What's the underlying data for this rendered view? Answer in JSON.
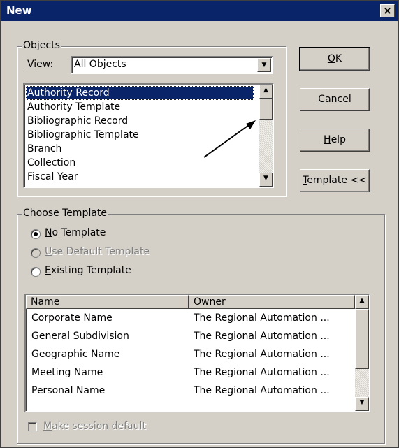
{
  "dialog": {
    "title": "New",
    "close_label": "×"
  },
  "objects": {
    "legend": "Objects",
    "view_label_pre": "",
    "view_label_key": "V",
    "view_label_post": "iew:",
    "view_value": "All Objects",
    "items": [
      {
        "label": "Authority Record",
        "selected": true
      },
      {
        "label": "Authority Template"
      },
      {
        "label": "Bibliographic Record"
      },
      {
        "label": "Bibliographic Template"
      },
      {
        "label": "Branch"
      },
      {
        "label": "Collection"
      },
      {
        "label": "Fiscal Year"
      }
    ]
  },
  "buttons": {
    "ok_key": "O",
    "ok_rest": "K",
    "cancel_key": "C",
    "cancel_rest": "ancel",
    "help_key": "H",
    "help_rest": "elp",
    "template_key": "T",
    "template_rest": "emplate <<"
  },
  "choose_template": {
    "legend": "Choose Template",
    "options": [
      {
        "key": "N",
        "rest": "o Template",
        "checked": true,
        "enabled": true
      },
      {
        "key": "U",
        "rest": "se Default Template",
        "checked": false,
        "enabled": false
      },
      {
        "key": "E",
        "rest": "xisting Template",
        "checked": false,
        "enabled": true
      }
    ],
    "columns": [
      "Name",
      "Owner"
    ],
    "rows": [
      {
        "name": "Corporate Name",
        "owner": "The Regional Automation ..."
      },
      {
        "name": "General Subdivision",
        "owner": "The Regional Automation ..."
      },
      {
        "name": "Geographic Name",
        "owner": "The Regional Automation ..."
      },
      {
        "name": "Meeting Name",
        "owner": "The Regional Automation ..."
      },
      {
        "name": "Personal Name",
        "owner": "The Regional Automation ..."
      }
    ],
    "session_default_key": "M",
    "session_default_rest": "ake session default",
    "session_default_checked": false
  },
  "colors": {
    "title_bar": "#0a246a",
    "face": "#d4d0c8",
    "selection": "#0a246a"
  }
}
